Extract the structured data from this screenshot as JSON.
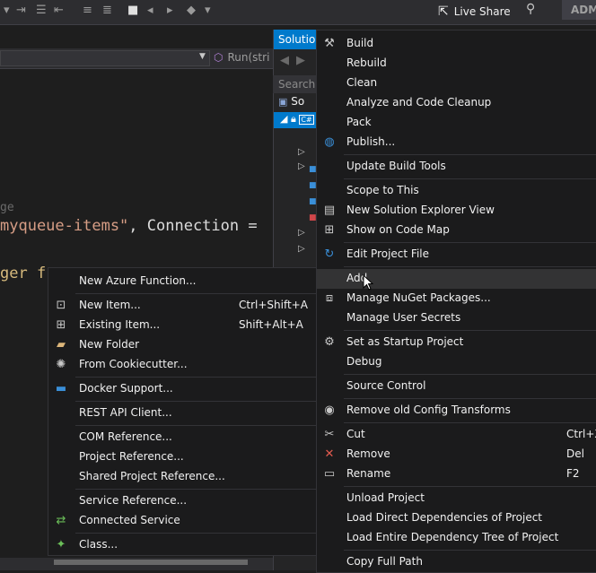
{
  "toolbar": {
    "live_share_label": "Live Share",
    "account_label": "ADM"
  },
  "navbar": {
    "right_label": "Run(stri"
  },
  "editor": {
    "line_partial": "ge",
    "line_queue_string": "myqueue-items\"",
    "line_queue_rest": ", Connection =",
    "line_trigger": "ger f"
  },
  "solution_explorer": {
    "tab_label": "Solution",
    "search_placeholder": "Search S",
    "row_solution": "So",
    "row_project_icon": "C#"
  },
  "main_menu": {
    "items": [
      {
        "label": "Build",
        "icon": "build-icon"
      },
      {
        "label": "Rebuild"
      },
      {
        "label": "Clean"
      },
      {
        "label": "Analyze and Code Cleanup"
      },
      {
        "label": "Pack"
      },
      {
        "label": "Publish...",
        "icon": "globe-icon"
      },
      {
        "label": "Update Build Tools"
      },
      {
        "label": "Scope to This"
      },
      {
        "label": "New Solution Explorer View",
        "icon": "new-view-icon"
      },
      {
        "label": "Show on Code Map",
        "icon": "code-map-icon"
      },
      {
        "label": "Edit Project File",
        "icon": "refresh-icon"
      },
      {
        "label": "Add"
      },
      {
        "label": "Manage NuGet Packages...",
        "icon": "nuget-icon"
      },
      {
        "label": "Manage User Secrets"
      },
      {
        "label": "Set as Startup Project",
        "icon": "gear-icon"
      },
      {
        "label": "Debug"
      },
      {
        "label": "Source Control"
      },
      {
        "label": "Remove old Config Transforms",
        "icon": "eye-icon"
      },
      {
        "label": "Cut",
        "shortcut": "Ctrl+X",
        "icon": "scissors-icon"
      },
      {
        "label": "Remove",
        "shortcut": "Del",
        "icon": "remove-x-icon"
      },
      {
        "label": "Rename",
        "shortcut": "F2",
        "icon": "rename-icon"
      },
      {
        "label": "Unload Project"
      },
      {
        "label": "Load Direct Dependencies of Project"
      },
      {
        "label": "Load Entire Dependency Tree of Project"
      },
      {
        "label": "Copy Full Path"
      }
    ]
  },
  "add_menu": {
    "items": [
      {
        "label": "New Azure Function..."
      },
      {
        "label": "New Item...",
        "shortcut": "Ctrl+Shift+A",
        "icon": "new-item-icon"
      },
      {
        "label": "Existing Item...",
        "shortcut": "Shift+Alt+A",
        "icon": "existing-item-icon"
      },
      {
        "label": "New Folder",
        "icon": "folder-icon"
      },
      {
        "label": "From Cookiecutter...",
        "icon": "cookiecutter-icon"
      },
      {
        "label": "Docker Support...",
        "icon": "docker-icon"
      },
      {
        "label": "REST API Client..."
      },
      {
        "label": "COM Reference..."
      },
      {
        "label": "Project Reference..."
      },
      {
        "label": "Shared Project Reference..."
      },
      {
        "label": "Service Reference..."
      },
      {
        "label": "Connected Service",
        "icon": "connected-service-icon"
      },
      {
        "label": "Class...",
        "icon": "class-icon"
      }
    ]
  },
  "colors": {
    "accent": "#007acc",
    "menu_bg": "#1b1b1c",
    "highlight": "#333334",
    "string": "#d69d85"
  }
}
